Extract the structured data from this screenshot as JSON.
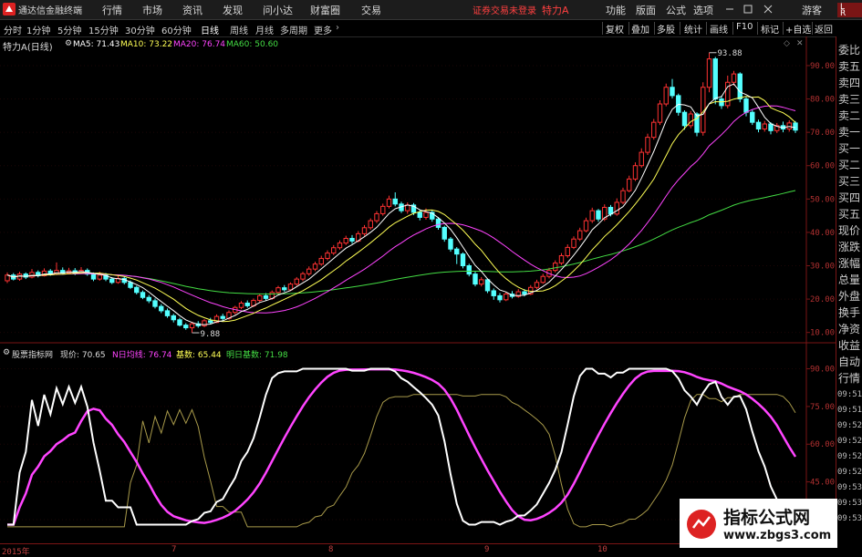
{
  "titlebar": {
    "app_name": "通达信金融终端",
    "menu": [
      "行情",
      "市场",
      "资讯",
      "发现",
      "问小达",
      "财富圈",
      "交易"
    ],
    "status": "证券交易未登录",
    "security_name": "特力A",
    "right": [
      "功能",
      "版面",
      "公式",
      "选项"
    ],
    "guest": "游客",
    "corner_L": "L",
    "corner_R": "R"
  },
  "toolbar": {
    "periods": [
      "分时",
      "1分钟",
      "5分钟",
      "15分钟",
      "30分钟",
      "60分钟",
      "日线",
      "周线",
      "月线",
      "多周期",
      "更多"
    ],
    "active_period": "日线",
    "buttons": [
      "复权",
      "叠加",
      "多股",
      "统计",
      "画线",
      "F10",
      "标记",
      "+自选",
      "返回"
    ]
  },
  "main_panel": {
    "title": "特力A(日线)",
    "ma": [
      {
        "label": "MA5: 71.43",
        "color": "#ffffff"
      },
      {
        "label": "MA10: 73.22",
        "color": "#ffff55"
      },
      {
        "label": "MA20: 76.74",
        "color": "#ff44ff"
      },
      {
        "label": "MA60: 50.60",
        "color": "#44dd44"
      }
    ],
    "y_ticks": [
      "90.00",
      "80.00",
      "70.00",
      "60.00",
      "50.00",
      "40.00",
      "30.00",
      "20.00",
      "10.00"
    ],
    "high_label": "93.88",
    "low_label": "9.88"
  },
  "indicator_panel": {
    "name": "股票指标网",
    "items": [
      {
        "label": "现价: 70.65",
        "color": "#dddddd"
      },
      {
        "label": "N日均线: 76.74",
        "color": "#ff44ff"
      },
      {
        "label": "基数: 65.44",
        "color": "#ffff55"
      },
      {
        "label": "明日基数: 71.98",
        "color": "#44dd44"
      }
    ],
    "y_ticks": [
      "90.00",
      "75.00",
      "60.00",
      "45.00",
      "30.00"
    ]
  },
  "x_axis": [
    "2015年",
    "7",
    "8",
    "9",
    "10"
  ],
  "sidebar": {
    "items": [
      "委比",
      "卖五",
      "卖四",
      "卖三",
      "卖二",
      "卖一",
      "买一",
      "买二",
      "买三",
      "买四",
      "买五",
      "现价",
      "涨跌",
      "涨幅",
      "总量",
      "外盘",
      "换手",
      "净资",
      "收益",
      "自动",
      "行情"
    ],
    "times": [
      "09:51",
      "09:51",
      "09:52",
      "09:52",
      "09:52",
      "09:52",
      "09:53",
      "09:53",
      "09:53"
    ]
  },
  "watermark": {
    "title": "指标公式网",
    "url": "www.zbgs3.com"
  },
  "colors": {
    "up": "#ff3232",
    "down": "#54ffff",
    "grid": "#7a1515",
    "ma5": "#ffffff",
    "ma10": "#ffff55",
    "ma20": "#ff44ff",
    "ma60": "#44dd44"
  },
  "chart_data": {
    "type": "candlestick",
    "ylim": [
      8,
      96
    ],
    "candles": [
      [
        25.5,
        27.2,
        28.0,
        24.8
      ],
      [
        27.2,
        26.0,
        27.8,
        25.6
      ],
      [
        26.0,
        27.5,
        28.2,
        25.5
      ],
      [
        27.5,
        26.6,
        28.0,
        26.0
      ],
      [
        26.6,
        28.0,
        29.0,
        26.2
      ],
      [
        28.0,
        27.0,
        28.6,
        26.5
      ],
      [
        27.0,
        28.4,
        29.2,
        26.8
      ],
      [
        28.4,
        27.5,
        29.0,
        27.0
      ],
      [
        27.5,
        28.6,
        31.0,
        27.2
      ],
      [
        28.6,
        27.8,
        29.5,
        27.3
      ],
      [
        27.8,
        28.5,
        29.4,
        27.4
      ],
      [
        28.5,
        27.8,
        29.3,
        27.2
      ],
      [
        27.8,
        28.6,
        29.6,
        27.5
      ],
      [
        28.6,
        27.5,
        29.2,
        27.0
      ],
      [
        27.5,
        26.0,
        28.0,
        25.4
      ],
      [
        26.0,
        27.2,
        28.2,
        25.5
      ],
      [
        27.2,
        26.0,
        27.8,
        25.4
      ],
      [
        26.0,
        25.0,
        26.6,
        24.5
      ],
      [
        25.0,
        26.2,
        27.0,
        24.6
      ],
      [
        26.2,
        25.0,
        26.8,
        24.4
      ],
      [
        25.0,
        23.5,
        25.6,
        23.0
      ],
      [
        23.5,
        22.0,
        24.0,
        21.4
      ],
      [
        22.0,
        20.5,
        22.6,
        20.0
      ],
      [
        20.5,
        19.5,
        21.2,
        18.8
      ],
      [
        19.5,
        17.8,
        20.2,
        17.2
      ],
      [
        17.8,
        16.5,
        18.5,
        15.8
      ],
      [
        16.5,
        15.0,
        17.2,
        14.4
      ],
      [
        15.0,
        13.8,
        15.6,
        13.0
      ],
      [
        13.8,
        12.2,
        14.4,
        11.8
      ],
      [
        12.2,
        11.4,
        12.8,
        10.8
      ],
      [
        11.4,
        12.6,
        13.2,
        9.9
      ],
      [
        12.6,
        12.0,
        13.4,
        11.4
      ],
      [
        12.0,
        13.5,
        14.0,
        11.6
      ],
      [
        13.5,
        13.0,
        14.4,
        12.4
      ],
      [
        13.0,
        14.8,
        15.4,
        12.8
      ],
      [
        14.8,
        14.2,
        15.6,
        13.6
      ],
      [
        14.2,
        16.0,
        16.6,
        13.8
      ],
      [
        16.0,
        17.5,
        18.0,
        15.4
      ],
      [
        17.5,
        18.8,
        19.4,
        17.0
      ],
      [
        18.8,
        18.0,
        19.6,
        17.4
      ],
      [
        18.0,
        19.6,
        20.2,
        17.6
      ],
      [
        19.6,
        21.0,
        21.6,
        19.0
      ],
      [
        21.0,
        20.2,
        21.8,
        19.6
      ],
      [
        20.2,
        22.0,
        22.6,
        19.8
      ],
      [
        22.0,
        23.4,
        24.0,
        21.4
      ],
      [
        23.4,
        22.8,
        24.2,
        22.2
      ],
      [
        22.8,
        24.5,
        25.0,
        22.4
      ],
      [
        24.5,
        26.0,
        26.6,
        24.0
      ],
      [
        26.0,
        27.6,
        28.2,
        25.4
      ],
      [
        27.6,
        29.0,
        29.8,
        27.0
      ],
      [
        29.0,
        30.5,
        31.2,
        28.4
      ],
      [
        30.5,
        32.2,
        33.0,
        30.0
      ],
      [
        32.2,
        33.8,
        34.6,
        31.6
      ],
      [
        33.8,
        35.4,
        36.2,
        33.2
      ],
      [
        35.4,
        36.8,
        37.6,
        34.8
      ],
      [
        36.8,
        38.2,
        39.0,
        36.2
      ],
      [
        38.2,
        37.4,
        39.2,
        36.6
      ],
      [
        37.4,
        39.6,
        40.4,
        37.0
      ],
      [
        39.6,
        41.4,
        42.2,
        39.0
      ],
      [
        41.4,
        43.5,
        44.2,
        40.8
      ],
      [
        43.5,
        45.6,
        46.4,
        42.8
      ],
      [
        45.6,
        47.8,
        48.6,
        45.0
      ],
      [
        47.8,
        50.0,
        51.0,
        47.2
      ],
      [
        50.0,
        48.5,
        52.0,
        47.8
      ],
      [
        48.5,
        46.5,
        49.2,
        45.8
      ],
      [
        46.5,
        48.2,
        49.0,
        45.6
      ],
      [
        48.2,
        46.0,
        48.8,
        45.2
      ],
      [
        46.0,
        44.5,
        46.8,
        43.6
      ],
      [
        44.5,
        46.0,
        47.2,
        43.8
      ],
      [
        46.0,
        44.0,
        46.6,
        43.2
      ],
      [
        44.0,
        41.5,
        44.6,
        40.8
      ],
      [
        41.5,
        38.0,
        42.0,
        37.2
      ],
      [
        38.0,
        35.0,
        38.6,
        34.2
      ],
      [
        35.0,
        33.5,
        35.6,
        30.5
      ],
      [
        33.5,
        30.0,
        34.0,
        29.2
      ],
      [
        30.0,
        27.5,
        30.6,
        26.8
      ],
      [
        27.5,
        24.5,
        28.2,
        23.8
      ],
      [
        24.5,
        25.8,
        26.6,
        23.8
      ],
      [
        25.8,
        22.5,
        26.2,
        21.8
      ],
      [
        22.5,
        21.0,
        23.2,
        19.8
      ],
      [
        21.0,
        19.8,
        21.8,
        19.0
      ],
      [
        19.8,
        21.5,
        22.2,
        19.4
      ],
      [
        21.5,
        20.8,
        22.4,
        20.2
      ],
      [
        20.8,
        22.2,
        23.0,
        20.4
      ],
      [
        22.2,
        21.5,
        23.0,
        20.8
      ],
      [
        21.5,
        23.5,
        24.2,
        21.2
      ],
      [
        23.5,
        25.0,
        25.8,
        23.0
      ],
      [
        25.0,
        26.8,
        27.6,
        24.6
      ],
      [
        26.8,
        28.6,
        29.4,
        26.2
      ],
      [
        28.6,
        30.8,
        31.6,
        28.0
      ],
      [
        30.8,
        33.0,
        33.8,
        30.2
      ],
      [
        33.0,
        35.5,
        36.4,
        32.4
      ],
      [
        35.5,
        38.0,
        38.8,
        35.0
      ],
      [
        38.0,
        40.5,
        41.4,
        37.4
      ],
      [
        40.5,
        43.5,
        44.4,
        40.0
      ],
      [
        43.5,
        46.5,
        47.4,
        42.8
      ],
      [
        46.5,
        44.0,
        47.0,
        43.2
      ],
      [
        44.0,
        47.5,
        48.4,
        43.4
      ],
      [
        47.5,
        45.5,
        48.2,
        44.8
      ],
      [
        45.5,
        49.0,
        50.2,
        45.0
      ],
      [
        49.0,
        52.5,
        53.4,
        48.4
      ],
      [
        52.5,
        56.0,
        57.0,
        52.0
      ],
      [
        56.0,
        60.0,
        61.0,
        55.4
      ],
      [
        60.0,
        64.0,
        65.2,
        59.4
      ],
      [
        64.0,
        68.5,
        69.6,
        63.2
      ],
      [
        68.5,
        73.0,
        74.0,
        67.8
      ],
      [
        73.0,
        78.5,
        79.6,
        72.2
      ],
      [
        78.5,
        83.5,
        84.6,
        77.8
      ],
      [
        83.5,
        81.0,
        86.0,
        80.2
      ],
      [
        81.0,
        76.0,
        81.6,
        75.0
      ],
      [
        76.0,
        72.0,
        76.6,
        70.8
      ],
      [
        72.0,
        75.5,
        76.4,
        71.2
      ],
      [
        75.5,
        70.0,
        76.0,
        68.8
      ],
      [
        70.0,
        83.5,
        85.0,
        69.0
      ],
      [
        83.5,
        92.0,
        93.88,
        82.0
      ],
      [
        92.0,
        80.0,
        92.6,
        78.4
      ],
      [
        80.0,
        78.0,
        81.0,
        77.0
      ],
      [
        78.0,
        85.0,
        87.0,
        77.2
      ],
      [
        85.0,
        87.5,
        88.4,
        84.0
      ],
      [
        87.5,
        80.0,
        88.0,
        79.0
      ],
      [
        80.0,
        76.0,
        80.8,
        74.8
      ],
      [
        76.0,
        73.0,
        76.8,
        72.2
      ],
      [
        73.0,
        71.0,
        73.8,
        70.0
      ],
      [
        71.0,
        72.5,
        73.4,
        70.2
      ],
      [
        72.5,
        70.5,
        73.0,
        69.4
      ],
      [
        70.5,
        72.0,
        72.8,
        69.8
      ],
      [
        72.0,
        71.0,
        73.2,
        70.0
      ],
      [
        71.0,
        72.8,
        73.6,
        70.2
      ],
      [
        72.8,
        70.65,
        73.4,
        69.8
      ]
    ],
    "ma": {
      "MA5": 71.43,
      "MA10": 73.22,
      "MA20": 76.74,
      "MA60": 50.6
    },
    "indicator": {
      "ylim": [
        22,
        96
      ],
      "current": 70.65,
      "n_day_avg": 76.74,
      "base": 65.44,
      "next_base": 71.98
    }
  }
}
